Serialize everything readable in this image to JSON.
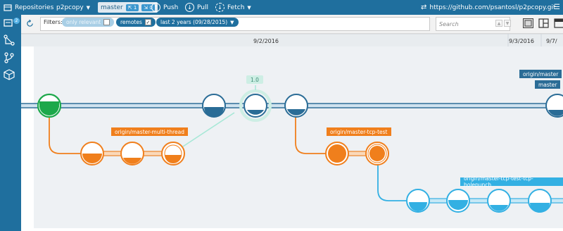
{
  "toolbar": {
    "repositories_label": "Repositories",
    "repo_name": "p2pcopy",
    "branch_name": "master",
    "ahead_badge": "⇱ 1",
    "behind_badge": "⇲ 0",
    "push_label": "Push",
    "pull_label": "Pull",
    "fetch_label": "Fetch",
    "remote_url": "https://github.com/psantosl/p2pcopy.git"
  },
  "rail": {
    "changes_badge": "2"
  },
  "filters": {
    "label": "Filters:",
    "only_relevant_label": "only relevant",
    "only_relevant_checked": "",
    "remotes_label": "remotes",
    "remotes_checked": "✓",
    "range_label": "last 2 years (09/28/2015)",
    "search_placeholder": "Search"
  },
  "graph": {
    "dates": [
      "9/2/2016",
      "9/3/2016",
      "9/7/"
    ],
    "tag": "1.0",
    "refs": {
      "origin_master": "origin/master",
      "master": "master",
      "multi_thread": "origin/master-multi-thread",
      "tcp_test": "origin/master-tcp-test",
      "holepunch": "origin/master-tcp-test-tcp-holepunch"
    }
  },
  "colors": {
    "toolbar_bg": "#1f6f9e",
    "master_blue": "#2a6c96",
    "orange": "#f07f1c",
    "cyan": "#33b0e3",
    "green": "#1ca84a",
    "teal_merge": "#a6e8d6"
  }
}
